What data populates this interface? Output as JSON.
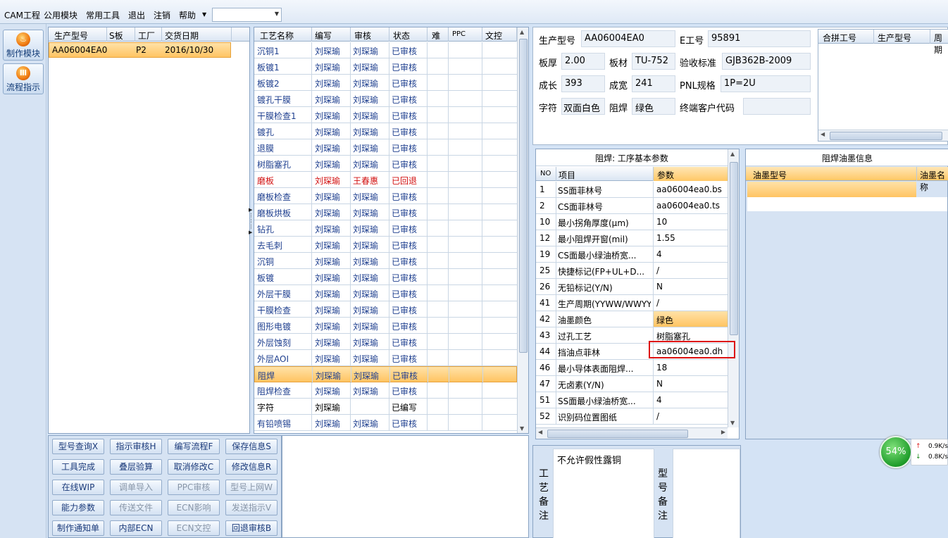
{
  "menu": {
    "items": [
      "CAM工程",
      "公用模块",
      "常用工具",
      "退出",
      "注销",
      "帮助"
    ],
    "combo_value": ""
  },
  "leftbar": {
    "make_module": "制作模块",
    "flow_guide": "流程指示"
  },
  "orders": {
    "headers": [
      "生产型号",
      "S板",
      "工厂",
      "交货日期"
    ],
    "rows": [
      {
        "model": "AA06004EA0",
        "s_board": "",
        "factory": "P2",
        "delivery": "2016/10/30"
      }
    ]
  },
  "process": {
    "headers": [
      "工艺名称",
      "编写",
      "审核",
      "状态",
      "难",
      "PPC",
      "文控"
    ],
    "rows": [
      {
        "name": "沉铜1",
        "writer": "刘琛瑜",
        "reviewer": "刘琛瑜",
        "status": "已审核"
      },
      {
        "name": "板镀1",
        "writer": "刘琛瑜",
        "reviewer": "刘琛瑜",
        "status": "已审核"
      },
      {
        "name": "板镀2",
        "writer": "刘琛瑜",
        "reviewer": "刘琛瑜",
        "status": "已审核"
      },
      {
        "name": "镀孔干膜",
        "writer": "刘琛瑜",
        "reviewer": "刘琛瑜",
        "status": "已审核"
      },
      {
        "name": "干膜检查1",
        "writer": "刘琛瑜",
        "reviewer": "刘琛瑜",
        "status": "已审核"
      },
      {
        "name": "镀孔",
        "writer": "刘琛瑜",
        "reviewer": "刘琛瑜",
        "status": "已审核"
      },
      {
        "name": "退膜",
        "writer": "刘琛瑜",
        "reviewer": "刘琛瑜",
        "status": "已审核"
      },
      {
        "name": "树脂塞孔",
        "writer": "刘琛瑜",
        "reviewer": "刘琛瑜",
        "status": "已审核"
      },
      {
        "name": "磨板",
        "writer": "刘琛瑜",
        "reviewer": "王春惠",
        "status": "已回退"
      },
      {
        "name": "磨板检查",
        "writer": "刘琛瑜",
        "reviewer": "刘琛瑜",
        "status": "已审核"
      },
      {
        "name": "磨板烘板",
        "writer": "刘琛瑜",
        "reviewer": "刘琛瑜",
        "status": "已审核"
      },
      {
        "name": "钻孔",
        "writer": "刘琛瑜",
        "reviewer": "刘琛瑜",
        "status": "已审核"
      },
      {
        "name": "去毛刺",
        "writer": "刘琛瑜",
        "reviewer": "刘琛瑜",
        "status": "已审核"
      },
      {
        "name": "沉铜",
        "writer": "刘琛瑜",
        "reviewer": "刘琛瑜",
        "status": "已审核"
      },
      {
        "name": "板镀",
        "writer": "刘琛瑜",
        "reviewer": "刘琛瑜",
        "status": "已审核"
      },
      {
        "name": "外层干膜",
        "writer": "刘琛瑜",
        "reviewer": "刘琛瑜",
        "status": "已审核"
      },
      {
        "name": "干膜检查",
        "writer": "刘琛瑜",
        "reviewer": "刘琛瑜",
        "status": "已审核"
      },
      {
        "name": "图形电镀",
        "writer": "刘琛瑜",
        "reviewer": "刘琛瑜",
        "status": "已审核"
      },
      {
        "name": "外层蚀刻",
        "writer": "刘琛瑜",
        "reviewer": "刘琛瑜",
        "status": "已审核"
      },
      {
        "name": "外层AOI",
        "writer": "刘琛瑜",
        "reviewer": "刘琛瑜",
        "status": "已审核"
      },
      {
        "name": "阻焊",
        "writer": "刘琛瑜",
        "reviewer": "刘琛瑜",
        "status": "已审核"
      },
      {
        "name": "阻焊检查",
        "writer": "刘琛瑜",
        "reviewer": "刘琛瑜",
        "status": "已审核"
      },
      {
        "name": "字符",
        "writer": "刘琛瑜",
        "reviewer": "",
        "status": "已编写"
      },
      {
        "name": "有铅喷锡",
        "writer": "刘琛瑜",
        "reviewer": "刘琛瑜",
        "status": "已审核"
      }
    ]
  },
  "actions": [
    [
      "型号查询X",
      "指示审核H",
      "编写流程F",
      "保存信息S"
    ],
    [
      "工具完成",
      "叠层验算",
      "取消修改C",
      "修改信息R"
    ],
    [
      "在线WIP",
      "调单导入",
      "PPC审核",
      "型号上网W"
    ],
    [
      "能力参数",
      "传送文件",
      "ECN影响",
      "发送指示V"
    ],
    [
      "制作通知单",
      "内部ECN",
      "ECN文控",
      "回退审核B"
    ]
  ],
  "info": {
    "model_label": "生产型号",
    "model": "AA06004EA0",
    "e_label": "E工号",
    "e_no": "95891",
    "thick_label": "板厚",
    "thick": "2.00",
    "material_label": "板材",
    "material": "TU-752",
    "std_label": "验收标准",
    "std": "GJB362B-2009",
    "len_label": "成长",
    "len": "393",
    "width_label": "成宽",
    "width": "241",
    "pnl_label": "PNL规格",
    "pnl": "1P=2U",
    "char_label": "字符",
    "char": "双面白色",
    "mask_label": "阻焊",
    "mask": "绿色",
    "cust_label": "终端客户代码",
    "cust": ""
  },
  "merge": {
    "headers": [
      "合拼工号",
      "生产型号",
      "周期"
    ]
  },
  "params": {
    "title": "阻焊: 工序基本参数",
    "headers": [
      "NO",
      "项目",
      "参数"
    ],
    "rows": [
      {
        "no": "1",
        "item": "SS面菲林号",
        "value": "aa06004ea0.bs"
      },
      {
        "no": "2",
        "item": "CS面菲林号",
        "value": "aa06004ea0.ts"
      },
      {
        "no": "10",
        "item": "最小拐角厚度(μm)",
        "value": "10"
      },
      {
        "no": "12",
        "item": "最小阻焊开窗(mil)",
        "value": "1.55"
      },
      {
        "no": "19",
        "item": "CS面最小绿油桥宽...",
        "value": "4"
      },
      {
        "no": "25",
        "item": "快捷标记(FP+UL+D...",
        "value": "/"
      },
      {
        "no": "26",
        "item": "无铅标记(Y/N)",
        "value": "N"
      },
      {
        "no": "41",
        "item": "生产周期(YYWW/WWYY)",
        "value": "/"
      },
      {
        "no": "42",
        "item": "油墨颜色",
        "value": "绿色"
      },
      {
        "no": "43",
        "item": "过孔工艺",
        "value": "树脂塞孔"
      },
      {
        "no": "44",
        "item": "挡油点菲林",
        "value": "aa06004ea0.dh"
      },
      {
        "no": "46",
        "item": "最小导体表面阻焊...",
        "value": "18"
      },
      {
        "no": "47",
        "item": "无卤素(Y/N)",
        "value": "N"
      },
      {
        "no": "51",
        "item": "SS面最小绿油桥宽...",
        "value": "4"
      },
      {
        "no": "52",
        "item": "识别码位置图纸",
        "value": "/"
      }
    ]
  },
  "ink": {
    "title": "阻焊油墨信息",
    "headers": [
      "油墨型号",
      "油墨名称"
    ]
  },
  "notes": {
    "process_label": "工艺备注",
    "process_text": "不允许假性露铜",
    "model_label": "型号备注",
    "model_text": ""
  },
  "net": {
    "percent": "54%",
    "up": "0.9K/s",
    "down": "0.8K/s"
  }
}
